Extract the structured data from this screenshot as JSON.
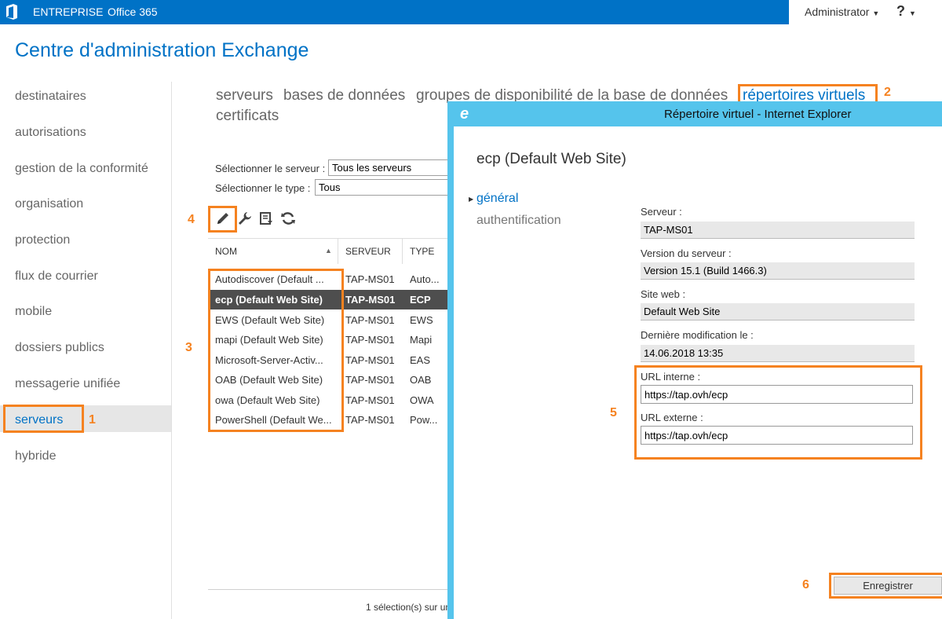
{
  "topbar": {
    "enterprise": "ENTREPRISE",
    "office365": "Office 365",
    "user": "Administrator",
    "help": "?"
  },
  "app_title": "Centre d'administration Exchange",
  "nav": [
    "destinataires",
    "autorisations",
    "gestion de la conformité",
    "organisation",
    "protection",
    "flux de courrier",
    "mobile",
    "dossiers publics",
    "messagerie unifiée",
    "serveurs",
    "hybride"
  ],
  "tabs": [
    "serveurs",
    "bases de données",
    "groupes de disponibilité de la base de données",
    "répertoires virtuels"
  ],
  "tab_second_line": "certificats",
  "filters": {
    "server_label": "Sélectionner le serveur :",
    "server_value": "Tous les serveurs",
    "type_label": "Sélectionner le type :",
    "type_value": "Tous"
  },
  "toolbar_icons": [
    "edit-icon",
    "wrench-icon",
    "reset-icon",
    "refresh-icon"
  ],
  "grid": {
    "headers": [
      "NOM",
      "SERVEUR",
      "TYPE"
    ],
    "rows": [
      [
        "Autodiscover (Default ...",
        "TAP-MS01",
        "Auto..."
      ],
      [
        "ecp (Default Web Site)",
        "TAP-MS01",
        "ECP"
      ],
      [
        "EWS (Default Web Site)",
        "TAP-MS01",
        "EWS"
      ],
      [
        "mapi (Default Web Site)",
        "TAP-MS01",
        "Mapi"
      ],
      [
        "Microsoft-Server-Activ...",
        "TAP-MS01",
        "EAS"
      ],
      [
        "OAB (Default Web Site)",
        "TAP-MS01",
        "OAB"
      ],
      [
        "owa (Default Web Site)",
        "TAP-MS01",
        "OWA"
      ],
      [
        "PowerShell (Default We...",
        "TAP-MS01",
        "Pow..."
      ]
    ],
    "selected_index": 1,
    "status": "1 sélection(s) sur un"
  },
  "dialog": {
    "window_title": "Répertoire virtuel - Internet Explorer",
    "heading": "ecp (Default Web Site)",
    "nav_general": "général",
    "nav_auth": "authentification",
    "server_label": "Serveur :",
    "server_value": "TAP-MS01",
    "version_label": "Version du serveur :",
    "version_value": "Version 15.1 (Build 1466.3)",
    "site_label": "Site web :",
    "site_value": "Default Web Site",
    "modified_label": "Dernière modification le :",
    "modified_value": "14.06.2018 13:35",
    "internal_url_label": "URL interne :",
    "internal_url_value": "https://tap.ovh/ecp",
    "external_url_label": "URL externe :",
    "external_url_value": "https://tap.ovh/ecp",
    "save_label": "Enregistrer"
  },
  "annotations": [
    "1",
    "2",
    "3",
    "4",
    "5",
    "6"
  ],
  "colors": {
    "accent": "#0072c6",
    "highlight": "#f58220",
    "dialog_title": "#55c4ec"
  }
}
